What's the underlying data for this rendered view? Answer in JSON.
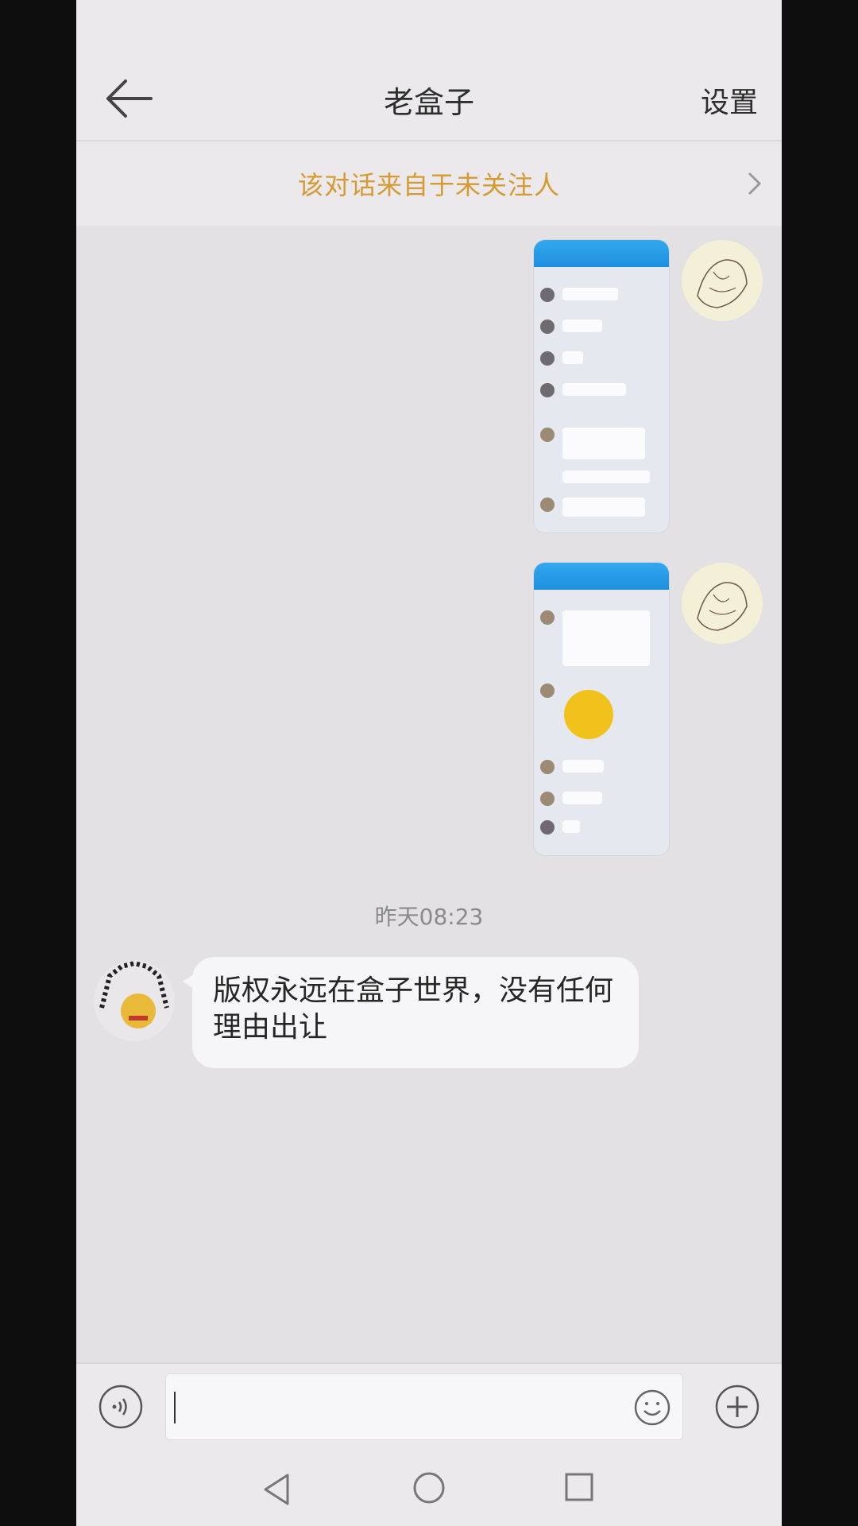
{
  "header": {
    "title": "老盒子",
    "settings_label": "设置"
  },
  "notice": {
    "text": "该对话来自于未关注人"
  },
  "messages": {
    "timestamp": "昨天08:23",
    "received_text": "版权永远在盒子世界，没有任何理由出让"
  },
  "icons": {
    "back": "arrow-left-icon",
    "chevron": "chevron-right-icon",
    "voice": "voice-icon",
    "emoji": "emoji-icon",
    "plus": "plus-icon",
    "nav_back": "triangle-back-icon",
    "nav_home": "circle-home-icon",
    "nav_recent": "square-recent-icon"
  },
  "colors": {
    "notice_text": "#d59a32",
    "shot_header": "#2a9de9",
    "background": "#e3e1e4"
  }
}
